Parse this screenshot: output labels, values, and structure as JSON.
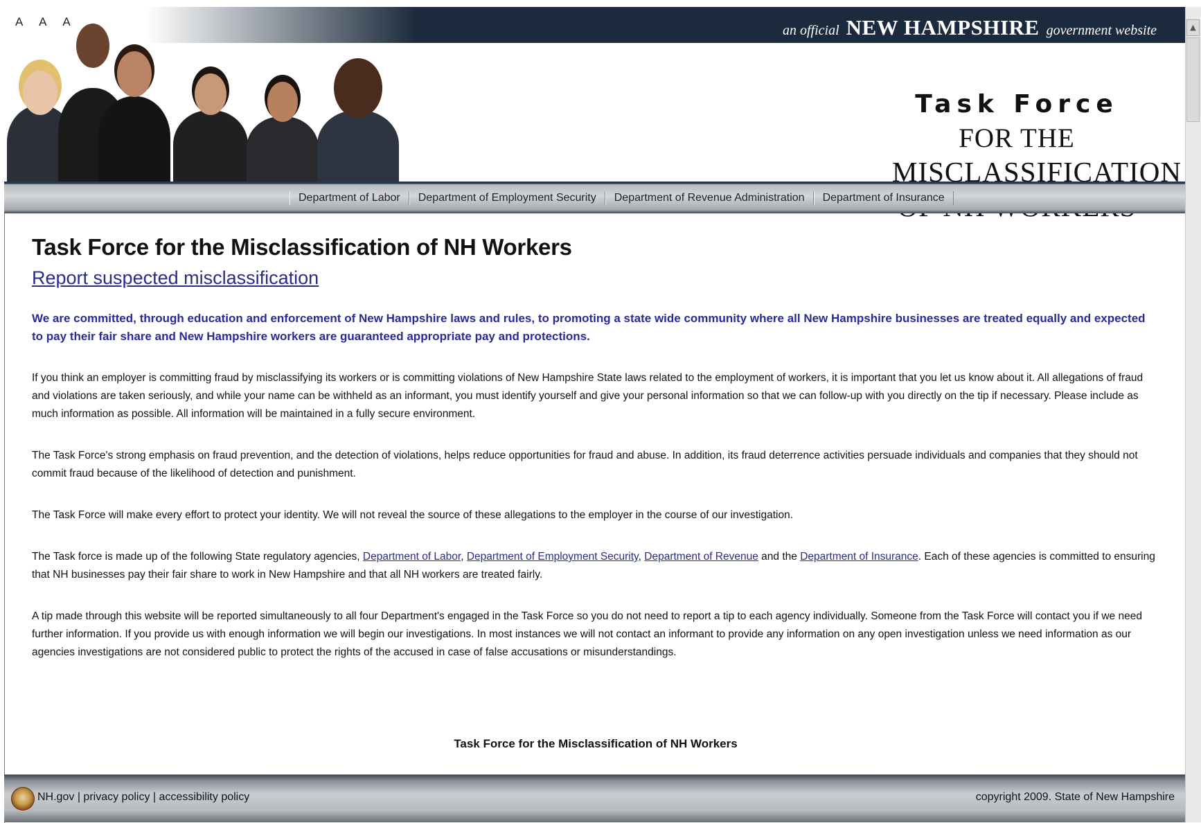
{
  "header": {
    "font_size_controls": "A A A",
    "official": {
      "prefix": "an official",
      "state": "NEW HAMPSHIRE",
      "suffix": "government website"
    },
    "brand": {
      "line1": "Task Force",
      "line2": "FOR THE",
      "line3": "MISCLASSIFICATION",
      "line4": "OF NH WORKERS"
    },
    "photo_label": "group of workers"
  },
  "nav": {
    "items": [
      {
        "label": "Department of Labor"
      },
      {
        "label": "Department of Employment Security"
      },
      {
        "label": "Department of Revenue Administration"
      },
      {
        "label": "Department of Insurance"
      }
    ]
  },
  "main": {
    "title": "Task Force for the Misclassification of NH Workers",
    "report_link": "Report suspected misclassification",
    "mission": "We are committed, through education and enforcement of New Hampshire laws and rules, to promoting a state wide community where all New Hampshire businesses are treated equally and expected to pay their fair share and New Hampshire workers are guaranteed appropriate pay and protections.",
    "para1": "If you think an employer is committing fraud by misclassifying its workers or is committing violations of New Hampshire State laws related to the employment of workers, it is important that you let us know about it. All allegations of fraud and violations are taken seriously, and while your name can be withheld as an informant, you must identify yourself and give your personal information so that we can follow-up with you directly on the tip if necessary. Please include as much information as possible. All information will be maintained in a fully secure environment.",
    "para2": "The Task Force's strong emphasis on fraud prevention, and the detection of violations, helps reduce opportunities for fraud and abuse. In addition, its fraud deterrence activities persuade individuals and companies that they should not commit fraud because of the likelihood of detection and punishment.",
    "para3": "The Task Force will make every effort to protect your identity. We will not reveal the source of these allegations to the employer in the course of our investigation.",
    "para4": {
      "prefix": "The Task force is made up of the following State regulatory agencies,",
      "link_labor": "Department of Labor",
      "sep1": ",",
      "link_employment": "Department of Employment Security",
      "sep2": ",",
      "link_revenue": "Department of Revenue",
      "and_the": "and the",
      "link_insurance": "Department of Insurance",
      "suffix": ". Each of these agencies is committed to ensuring that NH businesses pay their fair share to work in New Hampshire and that all NH workers are treated fairly."
    },
    "para5": "A tip made through this website will be reported simultaneously to all four Department's engaged in the Task Force so you do not need to report a tip to each agency individually. Someone from the Task Force will contact you if we need further information. If you provide us with enough information we will begin our investigations. In most instances we will not contact an informant to provide any information on any open investigation unless we need information as our agencies investigations are not considered public to protect the rights of the accused in case of false accusations or misunderstandings.",
    "footer_title": "Task Force for the Misclassification of NH Workers"
  },
  "footer": {
    "links": [
      "NH.gov",
      "privacy policy",
      "accessibility policy"
    ],
    "separator": "|",
    "copyright": "copyright 2009. State of New Hampshire",
    "seal_icon": "nh-state-seal-icon"
  },
  "scrollbar": {
    "up_arrow": "▲"
  },
  "colors": {
    "topbar": "#1b2a3c",
    "link": "#2b2b8a",
    "mission": "#2a2a95"
  }
}
